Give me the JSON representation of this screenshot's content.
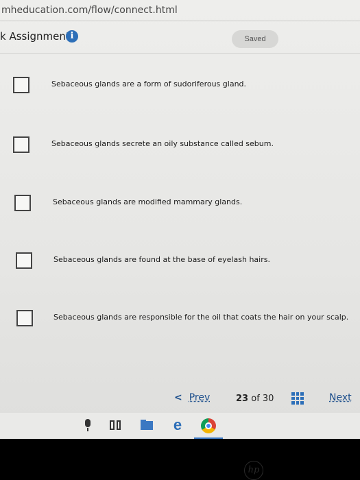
{
  "browser": {
    "url": "mheducation.com/flow/connect.html"
  },
  "header": {
    "title": "k Assignment",
    "info_icon": "info-icon",
    "saved_label": "Saved"
  },
  "options": [
    {
      "text": "Sebaceous glands are a form of sudoriferous gland."
    },
    {
      "text": "Sebaceous glands secrete an oily substance called sebum."
    },
    {
      "text": "Sebaceous glands are modified mammary glands."
    },
    {
      "text": "Sebaceous glands are found at the base of eyelash hairs."
    },
    {
      "text": "Sebaceous glands are responsible for the oil that coats the hair on your scalp."
    }
  ],
  "pager": {
    "prev_label": "Prev",
    "current": "23",
    "of_label": "of",
    "total": "30",
    "next_label": "Next"
  },
  "taskbar": {
    "icons": [
      "microphone-icon",
      "task-view-icon",
      "file-explorer-icon",
      "edge-browser-icon",
      "chrome-browser-icon"
    ]
  },
  "colors": {
    "accent": "#2d6fb8",
    "link": "#1d4f8c"
  }
}
